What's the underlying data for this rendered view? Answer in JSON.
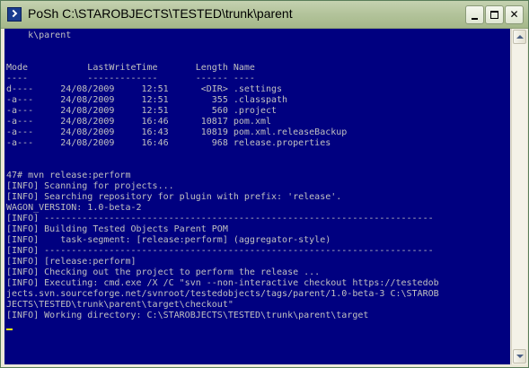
{
  "window": {
    "title": "PoSh C:\\STAROBJECTS\\TESTED\\trunk\\parent"
  },
  "titlebar": {
    "app_icon": "powershell-icon",
    "buttons": [
      "minimize-icon",
      "maximize-icon",
      "close-icon"
    ],
    "close_glyph": "✕"
  },
  "console": {
    "background": "#000080",
    "foreground": "#c0c0c0",
    "cursor_color": "#ffff00",
    "lines": [
      "    k\\parent",
      "",
      "",
      "Mode           LastWriteTime       Length Name",
      "----           -------------       ------ ----",
      "d----     24/08/2009     12:51      <DIR> .settings",
      "-a---     24/08/2009     12:51        355 .classpath",
      "-a---     24/08/2009     12:51        560 .project",
      "-a---     24/08/2009     16:46      10817 pom.xml",
      "-a---     24/08/2009     16:43      10819 pom.xml.releaseBackup",
      "-a---     24/08/2009     16:46        968 release.properties",
      "",
      "",
      "47# mvn release:perform",
      "[INFO] Scanning for projects...",
      "[INFO] Searching repository for plugin with prefix: 'release'.",
      "WAGON_VERSION: 1.0-beta-2",
      "[INFO] ------------------------------------------------------------------------",
      "[INFO] Building Tested Objects Parent POM",
      "[INFO]    task-segment: [release:perform] (aggregator-style)",
      "[INFO] ------------------------------------------------------------------------",
      "[INFO] [release:perform]",
      "[INFO] Checking out the project to perform the release ...",
      "[INFO] Executing: cmd.exe /X /C \"svn --non-interactive checkout https://testedob",
      "jects.svn.sourceforge.net/svnroot/testedobjects/tags/parent/1.0-beta-3 C:\\STAROB",
      "JECTS\\TESTED\\trunk\\parent\\target\\checkout\"",
      "[INFO] Working directory: C:\\STAROBJECTS\\TESTED\\trunk\\parent\\target"
    ]
  },
  "scrollbar": {
    "up_icon": "scroll-up-arrow-icon",
    "down_icon": "scroll-down-arrow-icon"
  }
}
